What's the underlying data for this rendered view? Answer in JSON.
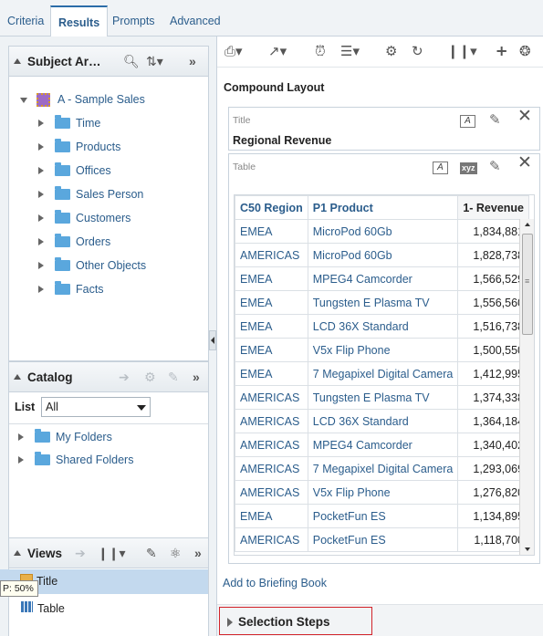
{
  "tabs": [
    "Criteria",
    "Results",
    "Prompts",
    "Advanced"
  ],
  "subject_area": {
    "title": "Subject Ar…",
    "root": "A - Sample Sales",
    "folders": [
      "Time",
      "Products",
      "Offices",
      "Sales Person",
      "Customers",
      "Orders",
      "Other Objects",
      "Facts"
    ]
  },
  "catalog": {
    "title": "Catalog",
    "list_label": "List",
    "list_value": "All",
    "folders": [
      "My Folders",
      "Shared Folders"
    ]
  },
  "views": {
    "title": "Views",
    "items": [
      "Title",
      "Table"
    ],
    "tooltip": "P: 50%"
  },
  "layout": {
    "heading": "Compound Layout",
    "title_view": {
      "caption": "Title",
      "value": "Regional Revenue"
    },
    "table_view": {
      "caption": "Table",
      "columns": [
        "C50 Region",
        "P1 Product",
        "1- Revenue"
      ],
      "rows": [
        [
          "EMEA",
          "MicroPod 60Gb",
          "1,834,881"
        ],
        [
          "AMERICAS",
          "MicroPod 60Gb",
          "1,828,738"
        ],
        [
          "EMEA",
          "MPEG4 Camcorder",
          "1,566,529"
        ],
        [
          "EMEA",
          "Tungsten E Plasma TV",
          "1,556,560"
        ],
        [
          "EMEA",
          "LCD 36X Standard",
          "1,516,738"
        ],
        [
          "EMEA",
          "V5x Flip Phone",
          "1,500,550"
        ],
        [
          "EMEA",
          "7 Megapixel Digital Camera",
          "1,412,995"
        ],
        [
          "AMERICAS",
          "Tungsten E Plasma TV",
          "1,374,338"
        ],
        [
          "AMERICAS",
          "LCD 36X Standard",
          "1,364,184"
        ],
        [
          "AMERICAS",
          "MPEG4 Camcorder",
          "1,340,402"
        ],
        [
          "AMERICAS",
          "7 Megapixel Digital Camera",
          "1,293,069"
        ],
        [
          "AMERICAS",
          "V5x Flip Phone",
          "1,276,820"
        ],
        [
          "EMEA",
          "PocketFun ES",
          "1,134,895"
        ],
        [
          "AMERICAS",
          "PocketFun ES",
          "1,118,700"
        ]
      ]
    }
  },
  "briefing_link": "Add to Briefing Book",
  "selection_steps": "Selection Steps"
}
